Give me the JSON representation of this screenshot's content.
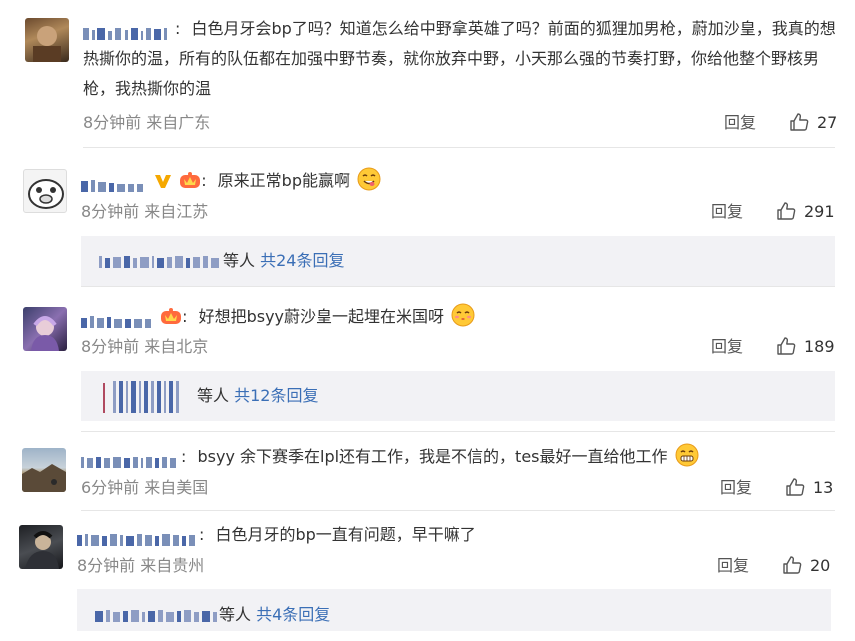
{
  "comments": [
    {
      "text": "白色月牙会bp了吗？知道怎么给中野拿英雄了吗？前面的狐狸加男枪，蔚加沙皇，我真的想热撕你的温，所有的队伍都在加强中野节奏，就你放弃中野，小天那么强的节奏打野，你给他整个野核男枪，我热撕你的温",
      "meta": "8分钟前 来自广东",
      "reply": "回复",
      "likes": "27"
    },
    {
      "text": "原来正常bp能赢啊",
      "meta": "8分钟前 来自江苏",
      "reply": "回复",
      "likes": "291",
      "thread_suffix": "等人",
      "thread_link": "共24条回复"
    },
    {
      "text": "好想把bsyy蔚沙皇一起埋在米国呀",
      "meta": "8分钟前 来自北京",
      "reply": "回复",
      "likes": "189",
      "thread_suffix": "等人",
      "thread_link": "共12条回复"
    },
    {
      "text": "bsyy 余下赛季在lpl还有工作，我是不信的，tes最好一直给他工作",
      "meta": "6分钟前 来自美国",
      "reply": "回复",
      "likes": "13"
    },
    {
      "text": "白色月牙的bp一直有问题，早干嘛了",
      "meta": "8分钟前 来自贵州",
      "reply": "回复",
      "likes": "20",
      "thread_suffix": "等人",
      "thread_link": "共4条回复"
    }
  ],
  "colon": ":",
  "icons": {
    "like": "thumbs-up-icon",
    "vip": "vip-v-icon",
    "crown": "member-crown-icon",
    "emoji": "yummy-face-emoji"
  },
  "colors": {
    "link": "#3b6fb6",
    "meta": "#888888",
    "thread_bg": "#f2f2f5"
  }
}
